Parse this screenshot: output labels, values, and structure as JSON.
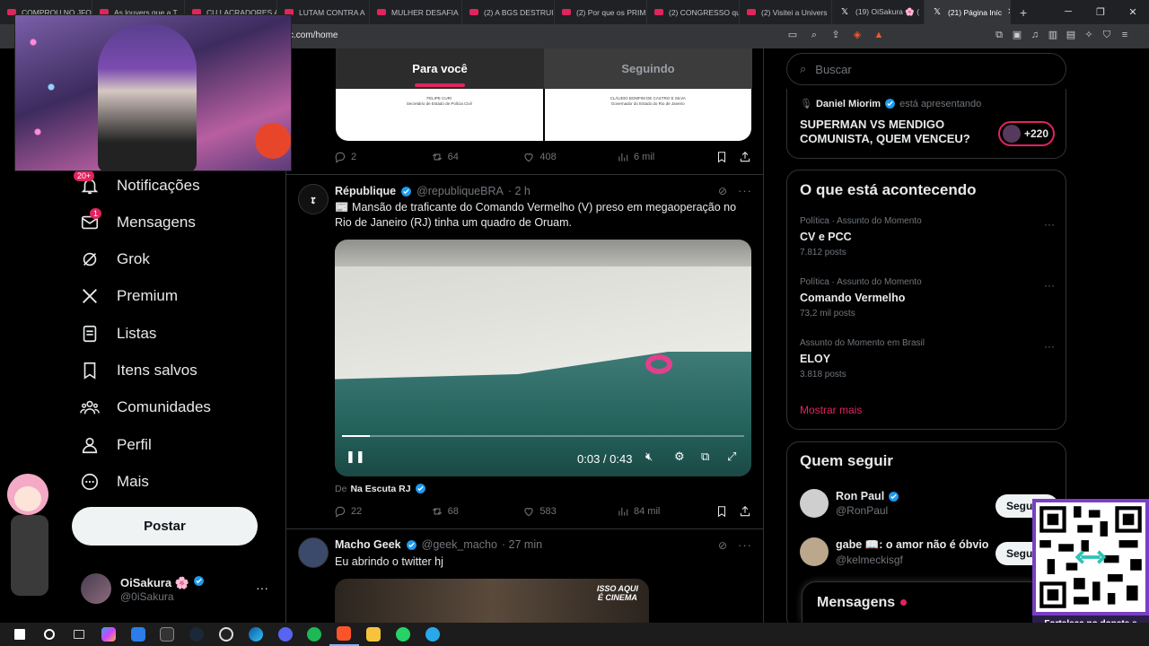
{
  "browser": {
    "tabs": [
      {
        "label": "COMPROU NO JFO",
        "icon": "youtube-icon"
      },
      {
        "label": "As louvers que a T",
        "icon": "youtube-icon"
      },
      {
        "label": "CU LACRADORES A",
        "icon": "youtube-icon"
      },
      {
        "label": "LUTAM CONTRA A",
        "icon": "youtube-icon"
      },
      {
        "label": "MULHER DESAFIA",
        "icon": "youtube-icon"
      },
      {
        "label": "(2) A BGS DESTRUI",
        "icon": "youtube-icon"
      },
      {
        "label": "(2) Por que os PRIM",
        "icon": "youtube-icon"
      },
      {
        "label": "(2) CONGRESSO qu",
        "icon": "youtube-icon"
      },
      {
        "label": "(2) Visitei a Univers",
        "icon": "youtube-icon"
      },
      {
        "label": "(19) OiSakura 🌸 (",
        "icon": "x-icon"
      },
      {
        "label": "(21) Página Iníc",
        "icon": "x-icon",
        "active": true
      }
    ],
    "new_tab": "+",
    "window_controls": {
      "minimize": "─",
      "restore": "❐",
      "close": "✕"
    },
    "url": "c.com/home"
  },
  "nav": {
    "items": [
      {
        "label": "Notificações",
        "icon": "bell-icon",
        "badge": "20+"
      },
      {
        "label": "Mensagens",
        "icon": "mail-icon",
        "badge": "1"
      },
      {
        "label": "Grok",
        "icon": "grok-icon"
      },
      {
        "label": "Premium",
        "icon": "x-logo-icon"
      },
      {
        "label": "Listas",
        "icon": "list-icon"
      },
      {
        "label": "Itens salvos",
        "icon": "bookmark-icon"
      },
      {
        "label": "Comunidades",
        "icon": "communities-icon"
      },
      {
        "label": "Perfil",
        "icon": "person-icon"
      },
      {
        "label": "Mais",
        "icon": "more-circle-icon"
      }
    ],
    "post_button": "Postar",
    "profile": {
      "name": "OiSakura 🌸",
      "handle": "@0iSakura",
      "more": "···"
    }
  },
  "feed": {
    "tabs": {
      "for_you": "Para você",
      "following": "Seguindo"
    },
    "doc_preview": {
      "left": "FELIPE CURI\nSecretário de Estado de Polícia Civil",
      "right": "CLÁUDIO BOMFIM DE CASTRO E SILVA\nGovernador do Estado do Rio de Janeiro"
    },
    "tweet1_stats": {
      "replies": "2",
      "reposts": "64",
      "likes": "408",
      "views": "6 mil"
    },
    "tweet2": {
      "name": "République",
      "handle": "@republiqueBRA",
      "time": "· 2 h",
      "text": "📰 Mansão de traficante do Comando Vermelho (V) preso em megaoperação no Rio de Janeiro (RJ) tinha um quadro de Oruam.",
      "video_time": "0:03 / 0:43",
      "video_progress": 0.07,
      "from_prefix": "De",
      "from_name": "Na Escuta RJ",
      "stats": {
        "replies": "22",
        "reposts": "68",
        "likes": "583",
        "views": "84 mil"
      }
    },
    "tweet3": {
      "name": "Macho Geek",
      "handle": "@geek_macho",
      "time": "· 27 min",
      "text": "Eu abrindo o twitter hj",
      "image_caption": "ISSO AQUI\nÉ CINEMA"
    }
  },
  "right": {
    "search_placeholder": "Buscar",
    "space": {
      "host": "Daniel Miorim",
      "host_suffix": "está apresentando",
      "title": "SUPERMAN VS MENDIGO COMUNISTA, QUEM VENCEU?",
      "count": "+220"
    },
    "trends_title": "O que está acontecendo",
    "trends": [
      {
        "context": "Política · Assunto do Momento",
        "title": "CV e PCC",
        "count": "7.812 posts"
      },
      {
        "context": "Política · Assunto do Momento",
        "title": "Comando Vermelho",
        "count": "73,2 mil posts"
      },
      {
        "context": "Assunto do Momento em Brasil",
        "title": "ELOY",
        "count": "3.818 posts"
      }
    ],
    "show_more": "Mostrar mais",
    "follow_title": "Quem seguir",
    "follow": [
      {
        "name": "Ron Paul",
        "handle": "@RonPaul",
        "verified": true,
        "button": "Seguir"
      },
      {
        "name": "gabe 📖: o amor não é óbvio",
        "handle": "@kelmeckisgf",
        "verified": false,
        "button": "Seguir"
      }
    ],
    "messages_drawer": "Mensagens"
  },
  "overlay": {
    "qr_caption": "Fortaleça no donate e envie sua mensagem!"
  },
  "colors": {
    "accent": "#e0245e",
    "verified": "#1d9bf0",
    "background": "#000000",
    "border": "#2f3336"
  }
}
